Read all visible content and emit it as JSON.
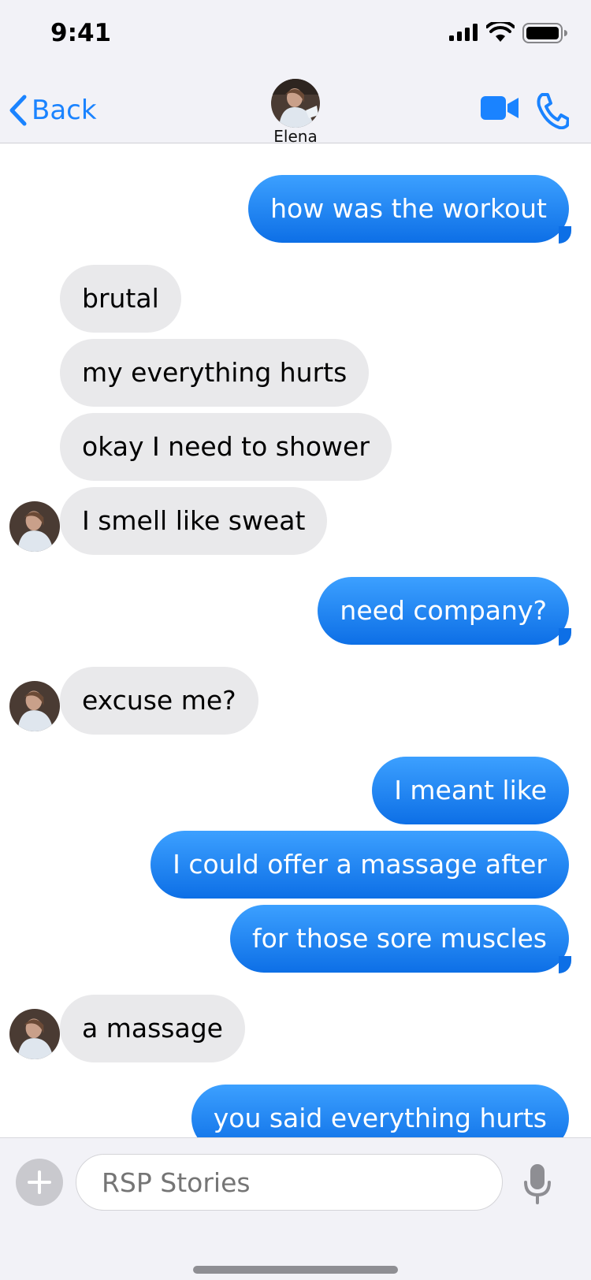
{
  "status_bar": {
    "time": "9:41"
  },
  "header": {
    "back_label": "Back",
    "contact_name": "Elena"
  },
  "messages": [
    {
      "side": "out",
      "text": "how was the workout"
    },
    {
      "side": "in",
      "text": "brutal"
    },
    {
      "side": "in",
      "text": "my everything hurts"
    },
    {
      "side": "in",
      "text": "okay I need to shower"
    },
    {
      "side": "in",
      "text": "I smell like sweat"
    },
    {
      "side": "out",
      "text": "need company?"
    },
    {
      "side": "in",
      "text": "excuse me?"
    },
    {
      "side": "out",
      "text": "I meant like"
    },
    {
      "side": "out",
      "text": "I could offer a massage after"
    },
    {
      "side": "out",
      "text": "for those sore muscles"
    },
    {
      "side": "in",
      "text": "a massage"
    },
    {
      "side": "out",
      "text": "you said everything hurts"
    }
  ],
  "composer": {
    "placeholder": "RSP Stories"
  },
  "colors": {
    "accent": "#1a83ff",
    "outgoing_bubble": "#0d6fe6",
    "incoming_bubble": "#e9e9eb"
  },
  "icons": [
    "signal-icon",
    "wifi-icon",
    "battery-icon",
    "back-chevron-icon",
    "video-camera-icon",
    "phone-icon",
    "plus-icon",
    "microphone-icon"
  ]
}
